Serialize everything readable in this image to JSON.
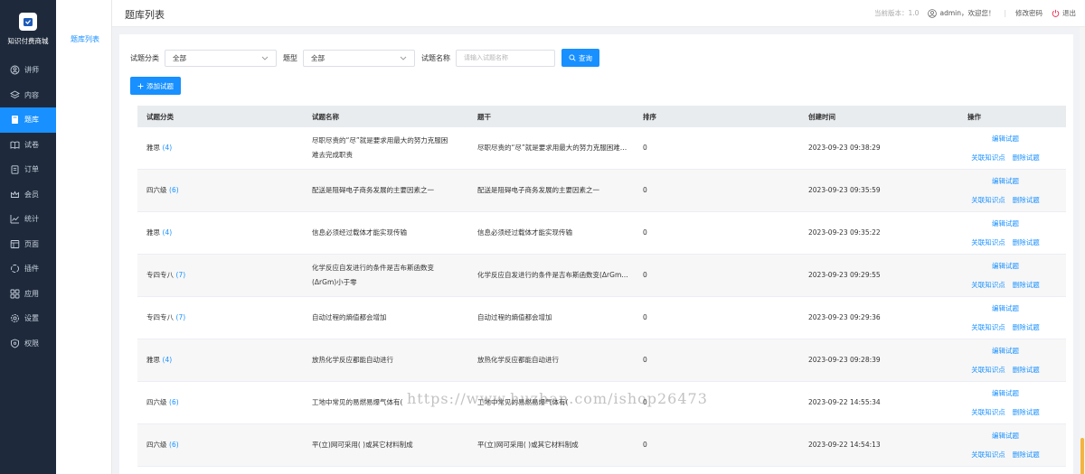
{
  "app": {
    "logo_text": "知识付费商城"
  },
  "sidebar": {
    "items": [
      {
        "label": "讲师",
        "icon": "lecturer-icon"
      },
      {
        "label": "内容",
        "icon": "layers-icon"
      },
      {
        "label": "题库",
        "icon": "book-icon",
        "active": true
      },
      {
        "label": "试卷",
        "icon": "open-book-icon"
      },
      {
        "label": "订单",
        "icon": "clipboard-icon"
      },
      {
        "label": "会员",
        "icon": "crown-icon"
      },
      {
        "label": "统计",
        "icon": "chart-icon"
      },
      {
        "label": "页面",
        "icon": "page-icon"
      },
      {
        "label": "插件",
        "icon": "plugin-icon"
      },
      {
        "label": "应用",
        "icon": "grid-icon"
      },
      {
        "label": "设置",
        "icon": "gear-icon"
      },
      {
        "label": "权限",
        "icon": "shield-icon"
      }
    ]
  },
  "submenu": {
    "item": "题库列表"
  },
  "header": {
    "title": "题库列表",
    "version": "当前版本：1.0",
    "user": "admin，欢迎您！",
    "separator": "|",
    "change_password": "修改密码",
    "logout": "退出"
  },
  "filters": {
    "category_label": "试题分类",
    "category_value": "全部",
    "type_label": "题型",
    "type_value": "全部",
    "name_label": "试题名称",
    "name_placeholder": "请输入试题名称",
    "search_button": "查询",
    "add_button": "添加试题"
  },
  "table": {
    "columns": [
      "试题分类",
      "试题名称",
      "题干",
      "排序",
      "创建时间",
      "操作"
    ],
    "rows": [
      {
        "category": "雅思",
        "count": "(4)",
        "name": "尽职尽责的“尽”就是要求用最大的努力克服困难去完成职责",
        "stem": "尽职尽责的“尽”就是要求用最大的努力克服困难去...",
        "sort": "0",
        "created": "2023-09-23 09:38:29"
      },
      {
        "category": "四六级",
        "count": "(6)",
        "name": "配送是阻碍电子商务发展的主要因素之一",
        "stem": "配送是阻碍电子商务发展的主要因素之一",
        "sort": "0",
        "created": "2023-09-23 09:35:59"
      },
      {
        "category": "雅思",
        "count": "(4)",
        "name": "信息必须经过载体才能实现传输",
        "stem": "信息必须经过载体才能实现传输",
        "sort": "0",
        "created": "2023-09-23 09:35:22"
      },
      {
        "category": "专四专八",
        "count": "(7)",
        "name": "化学反应自发进行的条件是吉布斯函数变(ΔrGm)小于零",
        "stem": "化学反应自发进行的条件是吉布斯函数变(ΔrGm)...",
        "sort": "0",
        "created": "2023-09-23 09:29:55"
      },
      {
        "category": "专四专八",
        "count": "(7)",
        "name": "自动过程的熵值都会增加",
        "stem": "自动过程的熵值都会增加",
        "sort": "0",
        "created": "2023-09-23 09:29:36"
      },
      {
        "category": "雅思",
        "count": "(4)",
        "name": "放热化学反应都能自动进行",
        "stem": "放热化学反应都能自动进行",
        "sort": "0",
        "created": "2023-09-23 09:28:39"
      },
      {
        "category": "四六级",
        "count": "(6)",
        "name": "工地中常见的易燃易爆气体有(",
        "stem": "工地中常见的易燃易爆气体有(",
        "sort": "0",
        "created": "2023-09-22 14:55:34"
      },
      {
        "category": "四六级",
        "count": "(6)",
        "name": "平(立)网可采用( )或其它材料制成",
        "stem": "平(立)网可采用( )或其它材料制成",
        "sort": "0",
        "created": "2023-09-22 14:54:13"
      }
    ],
    "actions": {
      "edit": "编辑试题",
      "link": "关联知识点",
      "delete": "删除试题"
    }
  },
  "watermark": "https://www.huzhan.com/ishop26473",
  "colors": {
    "sidebar_bg": "#1e2a3c",
    "accent": "#1890ff"
  }
}
